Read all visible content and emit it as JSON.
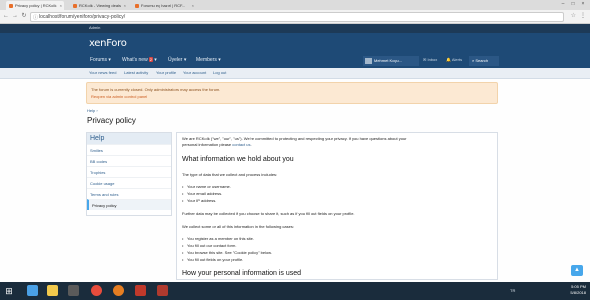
{
  "browser": {
    "tabs": [
      {
        "title": "Privacy policy | RCKoIk",
        "active": true
      },
      {
        "title": "RCKoIk - Viewing deals",
        "active": false
      },
      {
        "title": "Forumu eç hazırl | RCF...",
        "active": false
      }
    ],
    "url": "localhost/forum/yeniforo/privacy-policy/"
  },
  "forum": {
    "admin_label": "Admin",
    "logo": "xenForo",
    "nav": {
      "forums": "Forums",
      "whats_new": "What's new",
      "whats_new_badge": "2",
      "users": "Üyeler",
      "members": "Members"
    },
    "user_name": "Mehmet Koçu...",
    "inbox": "Inbox",
    "alerts": "Alerts",
    "search": "Search",
    "subnav": [
      "Your news feed",
      "Latest activity",
      "Your profile",
      "Your account",
      "Log out"
    ]
  },
  "notice": {
    "line1": "The forum is currently closed. Only administrators may access the forum.",
    "line2": "Reopen via admin control panel"
  },
  "breadcrumb": "Help",
  "page_title": "Privacy policy",
  "sidebar": {
    "heading": "Help",
    "items": [
      "Smilies",
      "BB codes",
      "Trophies",
      "Cookie usage",
      "Terms and rules",
      "Privacy policy"
    ]
  },
  "content": {
    "intro1": "We are RCKoIk (\"we\", \"our\", \"us\"). We're committed to protecting and respecting your privacy. If you have questions about your",
    "intro2_prefix": "personal information please ",
    "intro2_link": "contact us",
    "h1": "What information we hold about you",
    "types_intro": "The type of data that we collect and process includes:",
    "types": [
      "Your name or username.",
      "Your email address.",
      "Your IP address."
    ],
    "further": "Further data may be collected if you choose to share it, such as if you fill out fields on your profile.",
    "cases_intro": "We collect some or all of this information in the following cases:",
    "cases": [
      "You register as a member on this site.",
      "You fill out our contact form.",
      "You browse this site. See \"Cookie policy\" below.",
      "You fill out fields on your profile."
    ],
    "h2": "How your personal information is used"
  },
  "taskbar": {
    "tray_lang": "TR",
    "time": "5:05 PM",
    "date": "5/8/2018"
  }
}
